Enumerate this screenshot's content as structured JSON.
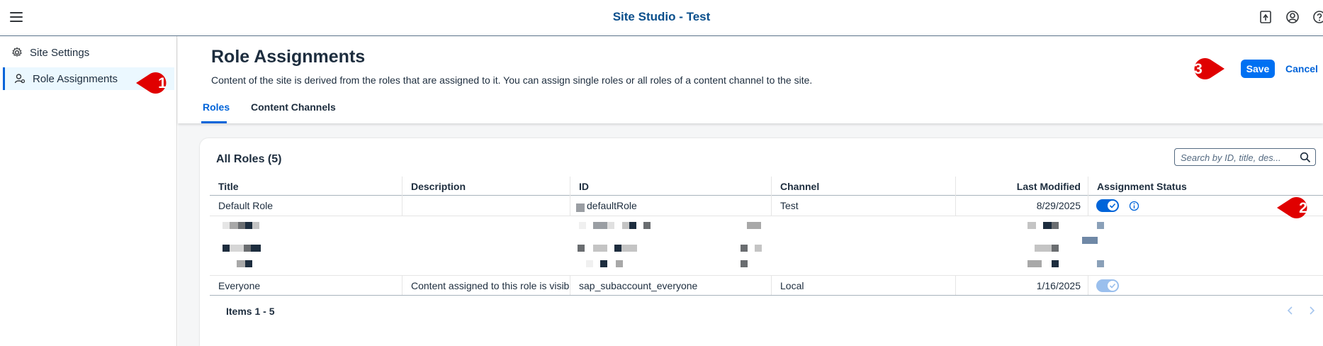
{
  "shellbar": {
    "title": "Site Studio - Test",
    "icons": [
      "menu-icon",
      "notes-icon",
      "user-icon",
      "help-icon"
    ]
  },
  "sidebar": {
    "items": [
      {
        "label": "Site Settings",
        "icon": "gear-icon",
        "selected": false
      },
      {
        "label": "Role Assignments",
        "icon": "user-role-icon",
        "selected": true
      }
    ]
  },
  "page": {
    "title": "Role Assignments",
    "description": "Content of the site is derived from the roles that are assigned to it. You can assign single roles or all roles of a content channel to the site.",
    "save_label": "Save",
    "cancel_label": "Cancel",
    "tabs": [
      {
        "label": "Roles",
        "active": true
      },
      {
        "label": "Content Channels",
        "active": false
      }
    ]
  },
  "table": {
    "title": "All Roles (5)",
    "search_placeholder": "Search by ID, title, des...",
    "columns": [
      "Title",
      "Description",
      "ID",
      "Channel",
      "Last Modified",
      "Assignment Status"
    ],
    "rows": [
      {
        "title": "Default Role",
        "description": "",
        "id": "defaultRole",
        "channel": "Test",
        "modified": "8/29/2025",
        "assigned": true
      },
      {
        "title": "Everyone",
        "description": "Content assigned to this role is visible to ...",
        "id": "sap_subaccount_everyone",
        "channel": "Local",
        "modified": "1/16/2025",
        "assigned": true
      }
    ],
    "footer": "Items 1 - 5"
  },
  "callouts": [
    "1",
    "2",
    "3"
  ],
  "colors": {
    "accent": "#0064d9",
    "save": "#0070f2",
    "callout": "#e00000",
    "shell_title": "#0a4f8c"
  }
}
